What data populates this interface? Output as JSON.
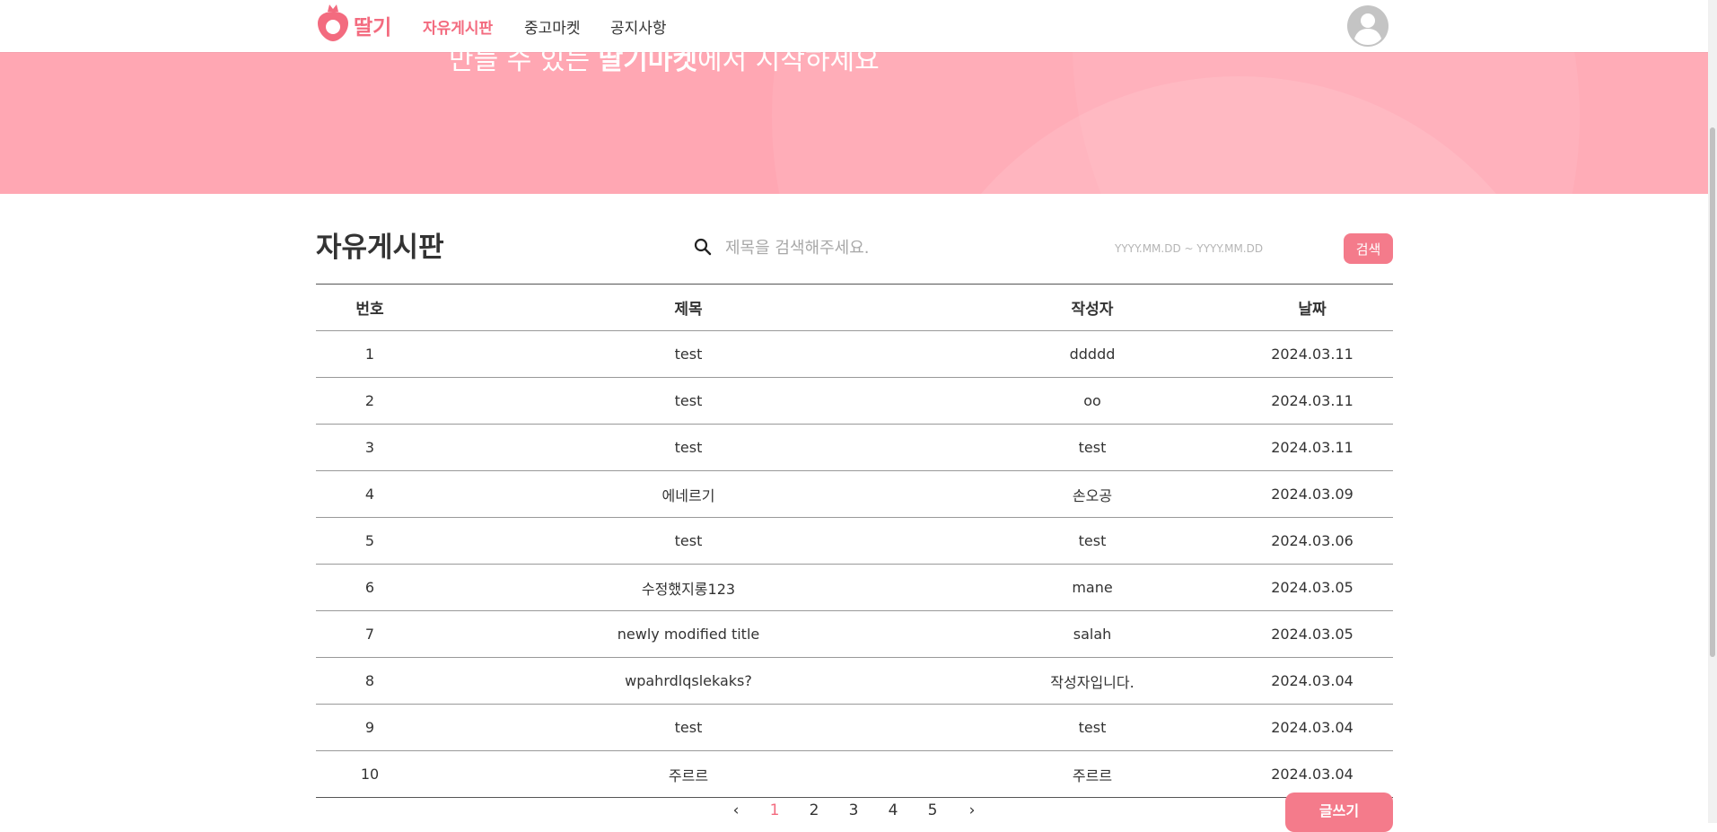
{
  "header": {
    "logo_text": "딸기",
    "nav": [
      {
        "label": "자유게시판",
        "active": true
      },
      {
        "label": "중고마켓",
        "active": false
      },
      {
        "label": "공지사항",
        "active": false
      }
    ]
  },
  "banner": {
    "text_prefix": "만들 수 있는 ",
    "text_bold": "딸기마켓",
    "text_suffix": "에서 시작하세요"
  },
  "board": {
    "title": "자유게시판",
    "search_placeholder": "제목을 검색해주세요.",
    "date_placeholder": "YYYY.MM.DD ~ YYYY.MM.DD",
    "search_button": "검색",
    "columns": [
      "번호",
      "제목",
      "작성자",
      "날짜"
    ],
    "rows": [
      {
        "no": "1",
        "title": "test",
        "author": "ddddd",
        "date": "2024.03.11"
      },
      {
        "no": "2",
        "title": "test",
        "author": "oo",
        "date": "2024.03.11"
      },
      {
        "no": "3",
        "title": "test",
        "author": "test",
        "date": "2024.03.11"
      },
      {
        "no": "4",
        "title": "에네르기",
        "author": "손오공",
        "date": "2024.03.09"
      },
      {
        "no": "5",
        "title": "test",
        "author": "test",
        "date": "2024.03.06"
      },
      {
        "no": "6",
        "title": "수정했지롱123",
        "author": "mane",
        "date": "2024.03.05"
      },
      {
        "no": "7",
        "title": "newly modified title",
        "author": "salah",
        "date": "2024.03.05"
      },
      {
        "no": "8",
        "title": "wpahrdlqslekaks?",
        "author": "작성자입니다.",
        "date": "2024.03.04"
      },
      {
        "no": "9",
        "title": "test",
        "author": "test",
        "date": "2024.03.04"
      },
      {
        "no": "10",
        "title": "주르르",
        "author": "주르르",
        "date": "2024.03.04"
      }
    ],
    "pagination": {
      "prev": "‹",
      "next": "›",
      "pages": [
        "1",
        "2",
        "3",
        "4",
        "5"
      ],
      "current": "1"
    },
    "write_button": "글쓰기"
  },
  "colors": {
    "accent": "#f36b7f",
    "banner": "#ffa7b3",
    "button": "#f47b8b"
  },
  "icons": {
    "logo": "strawberry-icon",
    "search": "search-icon",
    "avatar": "user-avatar-icon"
  }
}
